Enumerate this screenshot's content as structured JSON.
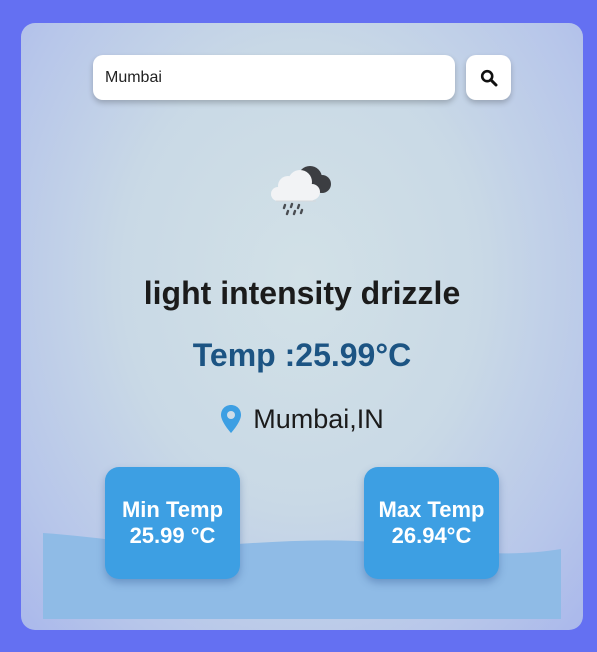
{
  "search": {
    "value": "Mumbai",
    "placeholder": ""
  },
  "weather": {
    "icon": "light-rain-cloud-icon",
    "description": "light intensity drizzle",
    "temp_line": "Temp :25.99°C",
    "location": "Mumbai,IN"
  },
  "stats": {
    "min_label": "Min Temp",
    "min_value": "25.99 °C",
    "max_label": "Max Temp",
    "max_value": "26.94°C"
  },
  "colors": {
    "page_background": "#6470f2",
    "accent_blue": "#3d9fe3",
    "temp_text": "#1c5483",
    "pin": "#3d9fe3"
  }
}
